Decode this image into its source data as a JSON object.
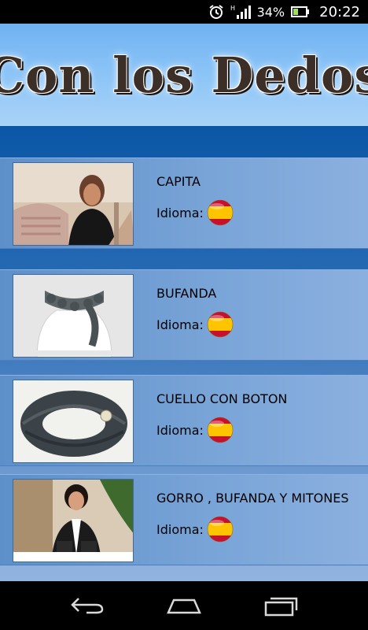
{
  "status_bar": {
    "battery_percent": "34%",
    "time": "20:22",
    "network": "H"
  },
  "header": {
    "title": "Con los Dedos"
  },
  "list": {
    "items": [
      {
        "title": "CAPITA",
        "language_label": "Idioma:",
        "flag": "spain-flag",
        "thumbnail": "woman-holding-knitted-cape"
      },
      {
        "title": "BUFANDA",
        "language_label": "Idioma:",
        "flag": "spain-flag",
        "thumbnail": "grey-scarf-on-mannequin"
      },
      {
        "title": "CUELLO CON BOTON",
        "language_label": "Idioma:",
        "flag": "spain-flag",
        "thumbnail": "grey-cowl-with-button"
      },
      {
        "title": "GORRO , BUFANDA Y MITONES",
        "language_label": "Idioma:",
        "flag": "spain-flag",
        "thumbnail": "woman-wearing-hat-scarf-mittens"
      }
    ]
  },
  "colors": {
    "header_bg": "#8fc6f7",
    "list_bg": "#0b56a6",
    "row_bg": "#7aa5d8",
    "flag_red": "#c8102e",
    "flag_yellow": "#ffc400"
  }
}
